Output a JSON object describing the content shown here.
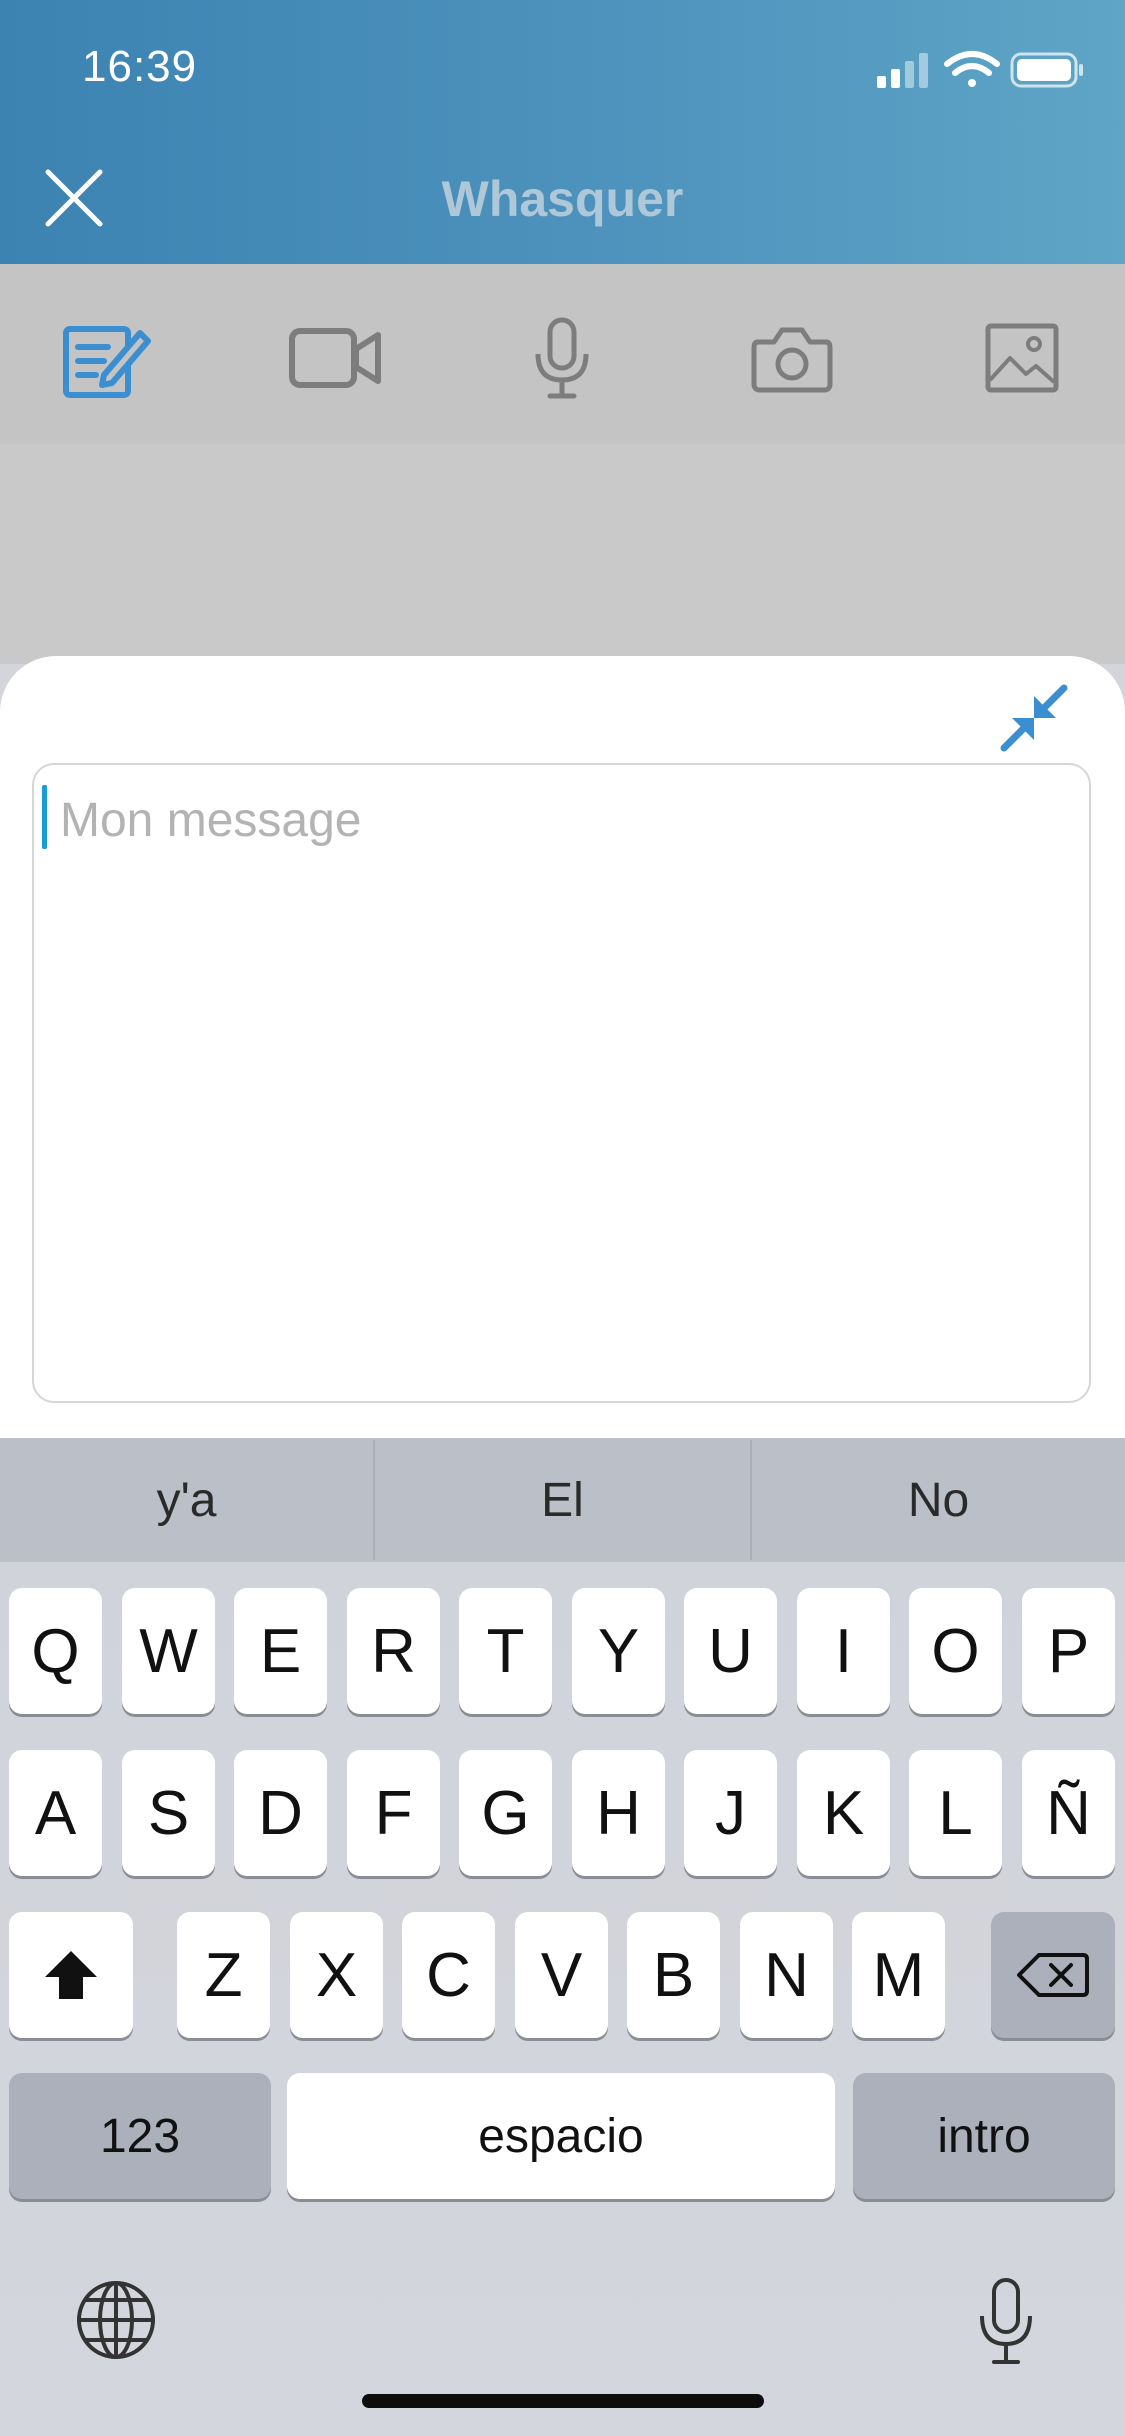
{
  "status_bar": {
    "time": "16:39"
  },
  "header": {
    "title": "Whasquer"
  },
  "toolbar": {
    "items": [
      {
        "icon": "edit-note-icon",
        "active": true
      },
      {
        "icon": "video-camera-icon"
      },
      {
        "icon": "microphone-icon"
      },
      {
        "icon": "camera-icon"
      },
      {
        "icon": "image-icon"
      }
    ]
  },
  "composer": {
    "placeholder": "Mon message",
    "value": ""
  },
  "keyboard": {
    "suggestions": [
      "y'a",
      "El",
      "No"
    ],
    "row1": [
      "Q",
      "W",
      "E",
      "R",
      "T",
      "Y",
      "U",
      "I",
      "O",
      "P"
    ],
    "row2": [
      "A",
      "S",
      "D",
      "F",
      "G",
      "H",
      "J",
      "K",
      "L",
      "Ñ"
    ],
    "row3": [
      "Z",
      "X",
      "C",
      "V",
      "B",
      "N",
      "M"
    ],
    "numbers_label": "123",
    "space_label": "espacio",
    "return_label": "intro"
  },
  "colors": {
    "accent": "#3b8fd0",
    "header_start": "#3c83b2",
    "header_end": "#5ea5c6"
  }
}
